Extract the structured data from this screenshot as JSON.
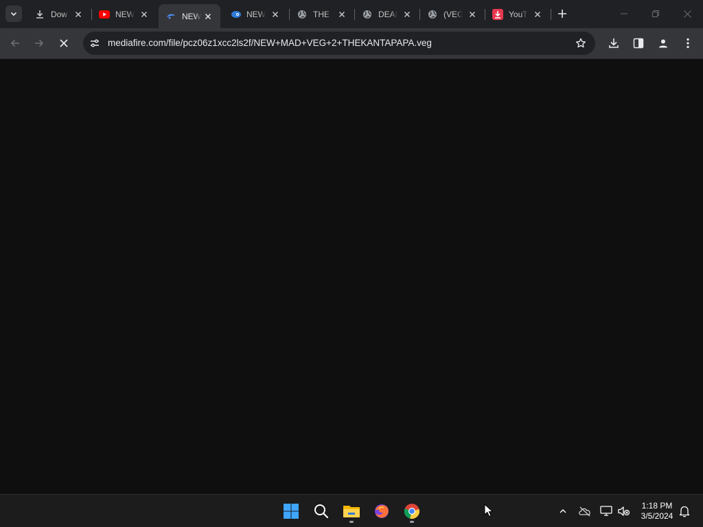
{
  "browser": {
    "tabs": [
      {
        "title": "Dow",
        "icon": "download-icon"
      },
      {
        "title": "NEW",
        "icon": "youtube-icon"
      },
      {
        "title": "NEW",
        "icon": "loading-icon",
        "active": true
      },
      {
        "title": "NEW",
        "icon": "fish-icon"
      },
      {
        "title": "THE",
        "icon": "globe-icon"
      },
      {
        "title": "DEAI",
        "icon": "globe-icon"
      },
      {
        "title": "(VEG",
        "icon": "globe-icon"
      },
      {
        "title": "YouT",
        "icon": "youtube-downloader-icon"
      }
    ],
    "address_bar": {
      "url": "mediafire.com/file/pcz06z1xcc2ls2f/NEW+MAD+VEG+2+THEKANTAPAPA.veg"
    },
    "page_loading": true
  },
  "taskbar": {
    "apps": [
      "windows-start-icon",
      "search-icon",
      "file-explorer-icon",
      "firefox-icon",
      "chrome-icon"
    ],
    "clock": {
      "time": "1:18 PM",
      "date": "3/5/2024"
    }
  },
  "colors": {
    "tabstrip": "#202124",
    "toolbar": "#35363a",
    "omnibox": "#202124",
    "content": "#0f0f0f",
    "taskbar": "#1c1c1c",
    "youtube_red": "#ff0000",
    "start_blue": "#3ea6ff"
  }
}
